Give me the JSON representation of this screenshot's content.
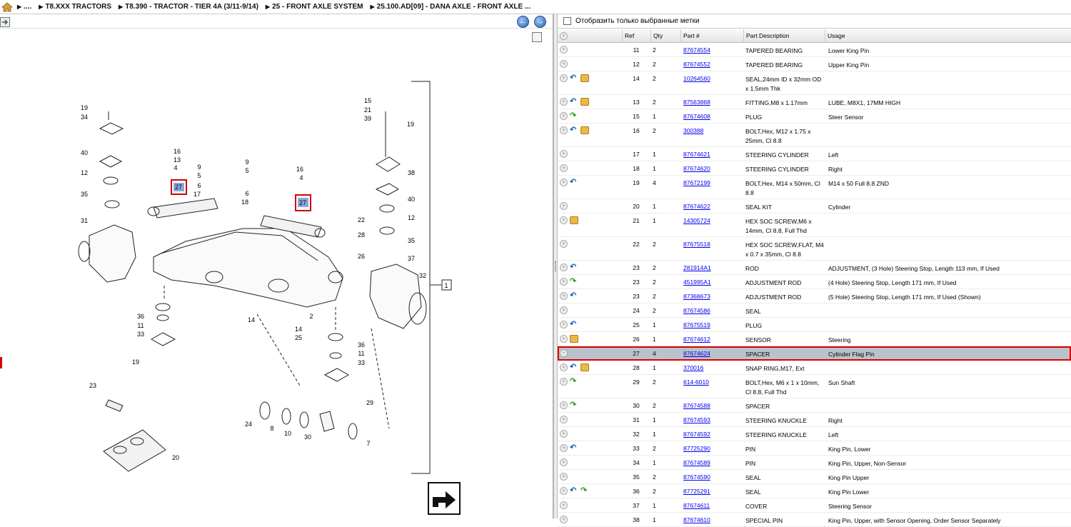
{
  "breadcrumb": {
    "items": [
      "....",
      "T8.XXX TRACTORS",
      "T8.390 - TRACTOR - TIER 4A (3/11-9/14)",
      "25 - FRONT AXLE SYSTEM",
      "25.100.AD[09] - DANA AXLE - FRONT AXLE ..."
    ]
  },
  "nav": {
    "back": "←",
    "forward": "→"
  },
  "filter": {
    "label": "Отобразить только выбранные метки"
  },
  "grid": {
    "headers": [
      "Ref",
      "Qty",
      "Part #",
      "Part Description",
      "Usage"
    ],
    "rows": [
      {
        "icons": [
          "plus"
        ],
        "ref": "11",
        "qty": "2",
        "part": "87674554",
        "desc": [
          "TAPERED BEARING"
        ],
        "usage": [
          "Lower King Pin"
        ]
      },
      {
        "icons": [
          "plus"
        ],
        "ref": "12",
        "qty": "2",
        "part": "87674552",
        "desc": [
          "TAPERED BEARING"
        ],
        "usage": [
          "Upper King Pin"
        ]
      },
      {
        "icons": [
          "plus",
          "blue",
          "box"
        ],
        "ref": "14",
        "qty": "2",
        "part": "10264560",
        "desc": [
          "SEAL,24mm ID x 32mm OD",
          "x 1.5mm Thk"
        ],
        "usage": [
          ""
        ]
      },
      {
        "icons": [
          "plus",
          "blue",
          "box"
        ],
        "ref": "13",
        "qty": "2",
        "part": "87563868",
        "desc": [
          "FITTING,M8 x 1.17mm"
        ],
        "usage": [
          "LUBE, M8X1, 17MM HIGH"
        ]
      },
      {
        "icons": [
          "plus",
          "green"
        ],
        "ref": "15",
        "qty": "1",
        "part": "87674608",
        "desc": [
          "PLUG"
        ],
        "usage": [
          "Steer Sensor"
        ]
      },
      {
        "icons": [
          "plus",
          "blue",
          "box"
        ],
        "ref": "16",
        "qty": "2",
        "part": "300388",
        "desc": [
          "BOLT,Hex, M12 x 1.75 x",
          "25mm, Cl 8.8"
        ],
        "usage": [
          ""
        ]
      },
      {
        "icons": [
          "plus"
        ],
        "ref": "17",
        "qty": "1",
        "part": "87674621",
        "desc": [
          "STEERING CYLINDER"
        ],
        "usage": [
          "Left"
        ]
      },
      {
        "icons": [
          "plus"
        ],
        "ref": "18",
        "qty": "1",
        "part": "87674620",
        "desc": [
          "STEERING CYLINDER"
        ],
        "usage": [
          "Right"
        ]
      },
      {
        "icons": [
          "plus",
          "blue"
        ],
        "ref": "19",
        "qty": "4",
        "part": "87672199",
        "desc": [
          "BOLT,Hex, M14 x 50mm, Cl",
          "8.8"
        ],
        "usage": [
          "M14 x 50 Full 8.8 ZND"
        ]
      },
      {
        "icons": [
          "plus"
        ],
        "ref": "20",
        "qty": "1",
        "part": "87674622",
        "desc": [
          "SEAL KIT"
        ],
        "usage": [
          "Cylinder"
        ]
      },
      {
        "icons": [
          "plus",
          "box"
        ],
        "ref": "21",
        "qty": "1",
        "part": "14305724",
        "desc": [
          "HEX SOC SCREW,M6 x",
          "14mm, Cl 8.8, Full Thd"
        ],
        "usage": [
          ""
        ]
      },
      {
        "icons": [
          "plus"
        ],
        "ref": "22",
        "qty": "2",
        "part": "87675518",
        "desc": [
          "HEX SOC SCREW,FLAT, M4",
          "x 0.7 x 35mm, Cl 8.8"
        ],
        "usage": [
          ""
        ]
      },
      {
        "icons": [
          "plus",
          "blue"
        ],
        "ref": "23",
        "qty": "2",
        "part": "281914A1",
        "desc": [
          "ROD"
        ],
        "usage": [
          "ADJUSTMENT, (3 Hole) Steering Stop, Length 113 mm, If Used"
        ]
      },
      {
        "icons": [
          "plus",
          "green"
        ],
        "ref": "23",
        "qty": "2",
        "part": "451995A1",
        "desc": [
          "ADJUSTMENT ROD"
        ],
        "usage": [
          "(4 Hole) Steering Stop, Length 171 mm, If Used"
        ]
      },
      {
        "icons": [
          "plus",
          "blue"
        ],
        "ref": "23",
        "qty": "2",
        "part": "87368673",
        "desc": [
          "ADJUSTMENT ROD"
        ],
        "usage": [
          "(5 Hole) Steering Stop, Length 171 mm, If Used (Shown)"
        ]
      },
      {
        "icons": [
          "plus"
        ],
        "ref": "24",
        "qty": "2",
        "part": "87674586",
        "desc": [
          "SEAL"
        ],
        "usage": [
          ""
        ]
      },
      {
        "icons": [
          "plus",
          "blue"
        ],
        "ref": "25",
        "qty": "1",
        "part": "87675519",
        "desc": [
          "PLUG"
        ],
        "usage": [
          ""
        ]
      },
      {
        "icons": [
          "plus",
          "box"
        ],
        "ref": "26",
        "qty": "1",
        "part": "87674612",
        "desc": [
          "SENSOR"
        ],
        "usage": [
          "Steering"
        ]
      },
      {
        "icons": [
          "plus"
        ],
        "ref": "27",
        "qty": "4",
        "part": "87674624",
        "desc": [
          "SPACER"
        ],
        "usage": [
          "Cylinder Flag Pin"
        ],
        "selected": true
      },
      {
        "icons": [
          "plus",
          "blue",
          "box"
        ],
        "ref": "28",
        "qty": "1",
        "part": "370016",
        "desc": [
          "SNAP RING,M17, Ext"
        ],
        "usage": [
          ""
        ]
      },
      {
        "icons": [
          "plus",
          "green"
        ],
        "ref": "29",
        "qty": "2",
        "part": "614-6010",
        "desc": [
          "BOLT,Hex, M6 x 1 x 10mm,",
          "Cl 8.8, Full Thd"
        ],
        "usage": [
          "Sun Shaft"
        ]
      },
      {
        "icons": [
          "plus",
          "green"
        ],
        "ref": "30",
        "qty": "2",
        "part": "87674588",
        "desc": [
          "SPACER"
        ],
        "usage": [
          ""
        ]
      },
      {
        "icons": [
          "plus"
        ],
        "ref": "31",
        "qty": "1",
        "part": "87674593",
        "desc": [
          "STEERING KNUCKLE"
        ],
        "usage": [
          "Right"
        ]
      },
      {
        "icons": [
          "plus"
        ],
        "ref": "32",
        "qty": "1",
        "part": "87674592",
        "desc": [
          "STEERING KNUCKLE"
        ],
        "usage": [
          "Left"
        ]
      },
      {
        "icons": [
          "plus",
          "blue"
        ],
        "ref": "33",
        "qty": "2",
        "part": "87725290",
        "desc": [
          "PIN"
        ],
        "usage": [
          "King Pin, Lower"
        ]
      },
      {
        "icons": [
          "plus"
        ],
        "ref": "34",
        "qty": "1",
        "part": "87674589",
        "desc": [
          "PIN"
        ],
        "usage": [
          "King Pin, Upper, Non-Sensor"
        ]
      },
      {
        "icons": [
          "plus"
        ],
        "ref": "35",
        "qty": "2",
        "part": "87674590",
        "desc": [
          "SEAL"
        ],
        "usage": [
          "King Pin Upper"
        ]
      },
      {
        "icons": [
          "plus",
          "blue",
          "green"
        ],
        "ref": "36",
        "qty": "2",
        "part": "87725291",
        "desc": [
          "SEAL"
        ],
        "usage": [
          "King Pin Lower"
        ]
      },
      {
        "icons": [
          "plus"
        ],
        "ref": "37",
        "qty": "1",
        "part": "87674611",
        "desc": [
          "COVER"
        ],
        "usage": [
          "Steering Sensor"
        ]
      },
      {
        "icons": [
          "plus"
        ],
        "ref": "38",
        "qty": "1",
        "part": "87674610",
        "desc": [
          "SPECIAL PIN"
        ],
        "usage": [
          "King Pin, Upper, with Sensor Opening, Order Sensor Separately"
        ]
      }
    ]
  },
  "diagram": {
    "callouts": [
      "19",
      "34",
      "40",
      "12",
      "35",
      "31",
      "16",
      "13",
      "4",
      "27",
      "9",
      "5",
      "6",
      "17",
      "9",
      "5",
      "6",
      "18",
      "16",
      "4",
      "27",
      "15",
      "21",
      "39",
      "19",
      "38",
      "40",
      "12",
      "35",
      "37",
      "22",
      "28",
      "26",
      "32",
      "1",
      "36",
      "11",
      "33",
      "19",
      "14",
      "14",
      "2",
      "25",
      "36",
      "11",
      "33",
      "29",
      "23",
      "24",
      "8",
      "10",
      "30",
      "7",
      "20"
    ],
    "highlighted": [
      "27",
      "27"
    ]
  },
  "colors": {
    "link": "#0000ee",
    "selection": "#b8c3cc",
    "highlight": "#d00000",
    "callout_box": "#8aa8e0"
  }
}
